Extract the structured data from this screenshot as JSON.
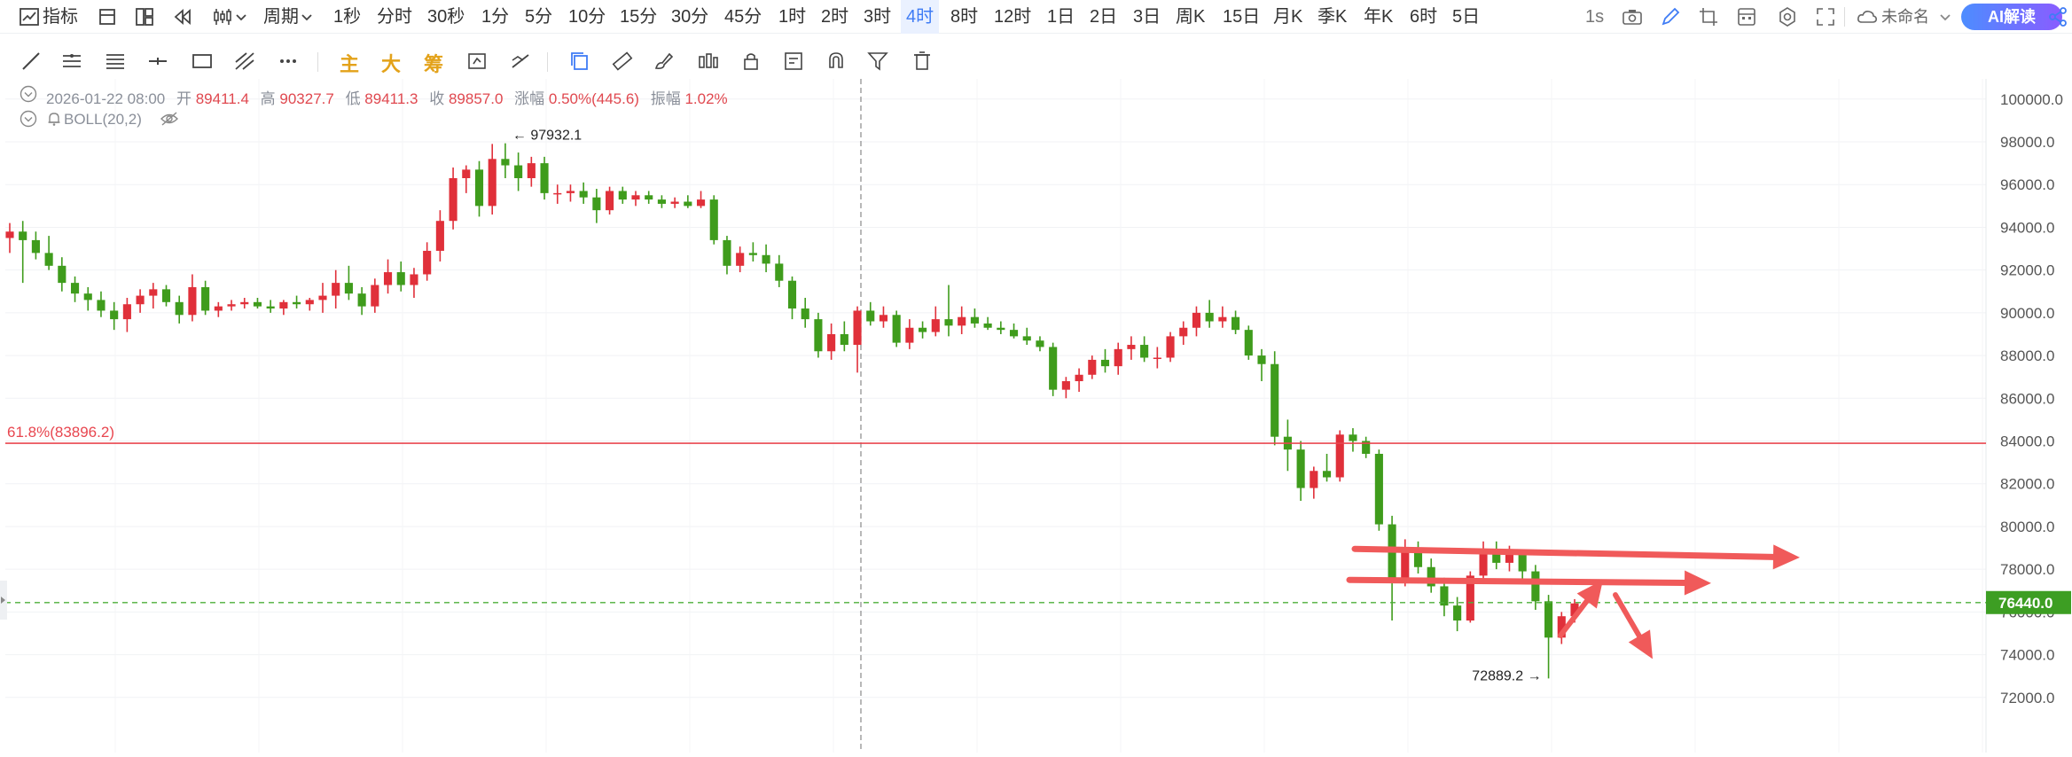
{
  "topbar": {
    "indicator_label": "指标",
    "period_label": "周期",
    "intervals": [
      "1秒",
      "分时",
      "30秒",
      "1分",
      "5分",
      "10分",
      "15分",
      "30分",
      "45分",
      "1时",
      "2时",
      "3时",
      "4时",
      "8时",
      "12时",
      "1日",
      "2日",
      "3日",
      "周K",
      "15日",
      "月K",
      "季K",
      "年K",
      "6时",
      "5日"
    ],
    "active_interval": "4时",
    "refresh_label": "1s",
    "layout_name": "未命名",
    "ai_button": "AI解读"
  },
  "toolbar": {
    "words": [
      "主",
      "大",
      "筹"
    ]
  },
  "ohlc": {
    "date": "2026-01-22 08:00",
    "open_label": "开",
    "open": "89411.4",
    "high_label": "高",
    "high": "90327.7",
    "low_label": "低",
    "low": "89411.3",
    "close_label": "收",
    "close": "89857.0",
    "change_label": "涨幅",
    "change": "0.50%(445.6)",
    "amp_label": "振幅",
    "amp": "1.02%"
  },
  "indicator": {
    "name": "BOLL(20,2)"
  },
  "colors": {
    "up": "#e0303a",
    "down": "#3f9c1c",
    "fib": "#e8464f",
    "price_line": "#4caf3a",
    "arrow": "#f05a5a"
  },
  "chart_data": {
    "type": "candlestick",
    "ylim": [
      71500,
      101000
    ],
    "y_ticks": [
      72000,
      74000,
      76000,
      78000,
      80000,
      82000,
      84000,
      86000,
      88000,
      90000,
      92000,
      94000,
      96000,
      98000,
      100000
    ],
    "y_tick_labels": [
      "72000.0",
      "74000.0",
      "76000.0",
      "78000.0",
      "80000.0",
      "82000.0",
      "84000.0",
      "86000.0",
      "88000.0",
      "90000.0",
      "92000.0",
      "94000.0",
      "96000.0",
      "98000.0",
      "100000.0"
    ],
    "ohlc": [
      [
        93500,
        94200,
        92800,
        93800
      ],
      [
        93800,
        94300,
        91400,
        93400
      ],
      [
        93400,
        93800,
        92500,
        92800
      ],
      [
        92800,
        93600,
        92000,
        92200
      ],
      [
        92200,
        92600,
        91000,
        91400
      ],
      [
        91400,
        91700,
        90500,
        90900
      ],
      [
        90900,
        91200,
        90100,
        90600
      ],
      [
        90600,
        91000,
        89800,
        90100
      ],
      [
        90100,
        90500,
        89200,
        89700
      ],
      [
        89700,
        90700,
        89100,
        90400
      ],
      [
        90400,
        91100,
        90000,
        90800
      ],
      [
        90800,
        91400,
        90200,
        91100
      ],
      [
        91100,
        91300,
        90300,
        90500
      ],
      [
        90500,
        90800,
        89500,
        89900
      ],
      [
        89900,
        91800,
        89600,
        91200
      ],
      [
        91200,
        91500,
        89900,
        90100
      ],
      [
        90100,
        90500,
        89800,
        90300
      ],
      [
        90300,
        90600,
        90100,
        90400
      ],
      [
        90400,
        90700,
        90200,
        90500
      ],
      [
        90500,
        90700,
        90200,
        90300
      ],
      [
        90300,
        90600,
        90000,
        90200
      ],
      [
        90200,
        90600,
        89900,
        90500
      ],
      [
        90500,
        90800,
        90200,
        90400
      ],
      [
        90400,
        90700,
        90100,
        90600
      ],
      [
        90600,
        91400,
        90000,
        90800
      ],
      [
        90800,
        92000,
        90200,
        91400
      ],
      [
        91400,
        92200,
        90600,
        90900
      ],
      [
        90900,
        91200,
        89900,
        90300
      ],
      [
        90300,
        91600,
        90000,
        91300
      ],
      [
        91300,
        92500,
        90900,
        91900
      ],
      [
        91900,
        92400,
        91000,
        91300
      ],
      [
        91300,
        92100,
        90700,
        91800
      ],
      [
        91800,
        93300,
        91500,
        92900
      ],
      [
        92900,
        94800,
        92400,
        94300
      ],
      [
        94300,
        96800,
        93900,
        96300
      ],
      [
        96300,
        96900,
        95600,
        96700
      ],
      [
        96700,
        97100,
        94500,
        95000
      ],
      [
        95000,
        97900,
        94600,
        97200
      ],
      [
        97200,
        97932,
        96300,
        96900
      ],
      [
        96900,
        97500,
        95700,
        96300
      ],
      [
        96300,
        97300,
        95900,
        97000
      ],
      [
        97000,
        97300,
        95300,
        95600
      ],
      [
        95600,
        96000,
        95100,
        95600
      ],
      [
        95600,
        96000,
        95200,
        95700
      ],
      [
        95700,
        96100,
        95100,
        95400
      ],
      [
        95400,
        95800,
        94200,
        94800
      ],
      [
        94800,
        95900,
        94600,
        95700
      ],
      [
        95700,
        95900,
        95100,
        95300
      ],
      [
        95300,
        95700,
        95000,
        95500
      ],
      [
        95500,
        95700,
        95100,
        95300
      ],
      [
        95300,
        95500,
        94900,
        95100
      ],
      [
        95100,
        95400,
        94900,
        95200
      ],
      [
        95200,
        95500,
        94900,
        95000
      ],
      [
        95000,
        95700,
        94900,
        95300
      ],
      [
        95300,
        95500,
        93200,
        93400
      ],
      [
        93400,
        93600,
        91800,
        92200
      ],
      [
        92200,
        93100,
        91900,
        92800
      ],
      [
        92800,
        93300,
        92400,
        92700
      ],
      [
        92700,
        93200,
        91900,
        92300
      ],
      [
        92300,
        92700,
        91200,
        91500
      ],
      [
        91500,
        91700,
        89700,
        90200
      ],
      [
        90200,
        90700,
        89300,
        89700
      ],
      [
        89700,
        90000,
        87900,
        88200
      ],
      [
        88200,
        89500,
        87800,
        89000
      ],
      [
        89000,
        89600,
        88200,
        88500
      ],
      [
        88500,
        90300,
        87200,
        90100
      ],
      [
        90100,
        90500,
        89400,
        89600
      ],
      [
        89600,
        90300,
        89300,
        89900
      ],
      [
        89900,
        90100,
        88400,
        88600
      ],
      [
        88600,
        89700,
        88300,
        89300
      ],
      [
        89300,
        89600,
        88800,
        89100
      ],
      [
        89100,
        90300,
        88900,
        89700
      ],
      [
        89700,
        91300,
        88900,
        89400
      ],
      [
        89400,
        90300,
        89000,
        89800
      ],
      [
        89800,
        90200,
        89300,
        89500
      ],
      [
        89500,
        89800,
        89200,
        89300
      ],
      [
        89300,
        89600,
        89000,
        89200
      ],
      [
        89200,
        89500,
        88800,
        88900
      ],
      [
        88900,
        89300,
        88500,
        88700
      ],
      [
        88700,
        88900,
        88200,
        88400
      ],
      [
        88400,
        88600,
        86100,
        86400
      ],
      [
        86400,
        87000,
        86000,
        86800
      ],
      [
        86800,
        87400,
        86300,
        87100
      ],
      [
        87100,
        88000,
        86900,
        87800
      ],
      [
        87800,
        88300,
        87200,
        87500
      ],
      [
        87500,
        88600,
        87100,
        88300
      ],
      [
        88300,
        88900,
        87800,
        88500
      ],
      [
        88500,
        88900,
        87700,
        87900
      ],
      [
        87900,
        88400,
        87400,
        87900
      ],
      [
        87900,
        89100,
        87700,
        88900
      ],
      [
        88900,
        89600,
        88500,
        89300
      ],
      [
        89300,
        90300,
        88900,
        90000
      ],
      [
        90000,
        90600,
        89300,
        89600
      ],
      [
        89600,
        90300,
        89300,
        89800
      ],
      [
        89800,
        90100,
        89000,
        89200
      ],
      [
        89200,
        89400,
        87800,
        88000
      ],
      [
        88000,
        88300,
        86800,
        87600
      ],
      [
        87600,
        88200,
        83800,
        84200
      ],
      [
        84200,
        85000,
        82600,
        83600
      ],
      [
        83600,
        84000,
        81200,
        81800
      ],
      [
        81800,
        82800,
        81300,
        82600
      ],
      [
        82600,
        83400,
        82100,
        82300
      ],
      [
        82300,
        84500,
        82100,
        84300
      ],
      [
        84300,
        84600,
        83500,
        84000
      ],
      [
        84000,
        84200,
        83200,
        83400
      ],
      [
        83400,
        83600,
        79800,
        80100
      ],
      [
        80100,
        80500,
        75600,
        77500
      ],
      [
        77500,
        79400,
        77200,
        79000
      ],
      [
        79000,
        79300,
        77800,
        78100
      ],
      [
        78100,
        78500,
        76900,
        77200
      ],
      [
        77200,
        77600,
        75800,
        76300
      ],
      [
        76300,
        76700,
        75100,
        75600
      ],
      [
        75600,
        77900,
        75500,
        77700
      ],
      [
        77700,
        79300,
        77400,
        78900
      ],
      [
        78900,
        79300,
        78000,
        78300
      ],
      [
        78300,
        79100,
        77900,
        78700
      ],
      [
        78700,
        78900,
        77500,
        77900
      ],
      [
        77900,
        78200,
        76100,
        76500
      ],
      [
        76500,
        76800,
        72889,
        74800
      ],
      [
        74800,
        76000,
        74500,
        75800
      ],
      [
        75800,
        76600,
        75500,
        76400
      ]
    ],
    "last_price": 76440.0,
    "last_price_label": "76440.0",
    "max_label": "97932.1",
    "min_label": "72889.2",
    "fib_level": 83896.2,
    "fib_label": "61.8%(83896.2)",
    "grid": true
  }
}
